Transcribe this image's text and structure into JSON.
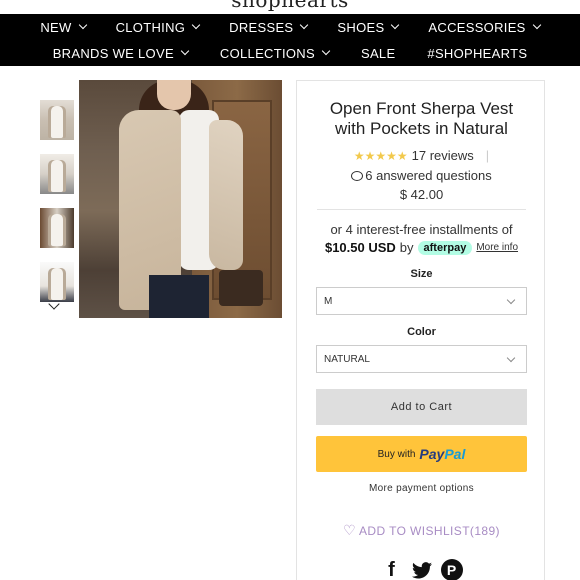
{
  "brand": {
    "logo": "shophearts"
  },
  "nav": {
    "row1": [
      "NEW",
      "CLOTHING",
      "DRESSES",
      "SHOES",
      "ACCESSORIES"
    ],
    "row2": [
      "BRANDS WE LOVE",
      "COLLECTIONS",
      "SALE",
      "#SHOPHEARTS"
    ],
    "row2_has_dropdown": [
      true,
      true,
      false,
      false
    ]
  },
  "product": {
    "title_line1": "Open Front Sherpa Vest",
    "title_line2": "with Pockets in Natural",
    "stars": "★★★★★",
    "reviews": "17 reviews",
    "separator": "|",
    "questions": "6 answered questions",
    "price": "$ 42.00"
  },
  "installments": {
    "line1": "or 4 interest-free installments of",
    "amount": "$10.50 USD",
    "by": "by",
    "provider": "afterpay",
    "more_info": "More info"
  },
  "options": {
    "size_label": "Size",
    "size_value": "M",
    "color_label": "Color",
    "color_value": "NATURAL"
  },
  "actions": {
    "add_to_cart": "Add to Cart",
    "buy_with": "Buy with",
    "paypal_pay": "Pay",
    "paypal_pal": "Pal",
    "more_payment": "More payment options",
    "wishlist": "ADD TO WISHLIST",
    "wishlist_count": "(189)"
  },
  "social": {
    "facebook": "f",
    "pinterest": "P"
  },
  "icons": {
    "nav_dropdown": "chevron-down-icon",
    "thumb_scroll": "chevron-down-icon",
    "questions": "speech-bubble-icon",
    "wishlist": "heart-icon",
    "social": [
      "facebook-icon",
      "twitter-icon",
      "pinterest-icon"
    ]
  },
  "colors": {
    "nav_bg": "#000000",
    "star": "#f2c94c",
    "afterpay": "#b2fce4",
    "paypal_button": "#ffc43a",
    "wishlist": "#a88cc4",
    "add_to_cart_bg": "#dedede"
  }
}
